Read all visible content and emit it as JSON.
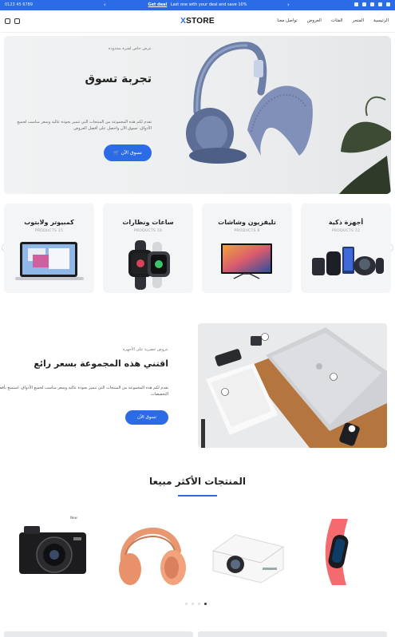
{
  "topbar": {
    "phone": "0123 45 6789",
    "promo_link": "Get deal",
    "promo_text": "Last one with your deal and save 10%",
    "prev_arrow": "‹",
    "next_arrow": "›"
  },
  "header": {
    "logo_prefix": "X",
    "logo_text": "STORE",
    "nav": [
      "الرئيسية",
      "المتجر",
      "الفئات",
      "العروض",
      "تواصل معنا"
    ]
  },
  "hero": {
    "eyebrow": "عرض خاص لفترة محدودة",
    "title": "تجربة تسوق",
    "description": "تقدم لكم هذه المجموعة من المنتجات التي تتميز بجودة عالية وسعر مناسب لجميع الأذواق، تسوق الآن واحصل على أفضل العروض",
    "button_label": "تسوق الآن",
    "button_icon": "cart-icon"
  },
  "categories": [
    {
      "name": "أجهزة ذكية",
      "count": "PRODUCTS 12"
    },
    {
      "name": "تليفزيون وشاشات",
      "count": "PRODUCTS 8"
    },
    {
      "name": "ساعات ونظارات",
      "count": "PRODUCTS 10"
    },
    {
      "name": "كمبيوتر ولابتوب",
      "count": "PRODUCTS 15"
    }
  ],
  "category_nav": {
    "prev": "‹",
    "next": "›"
  },
  "promo": {
    "eyebrow": "عروض حصرية على الأجهزة",
    "title": "اقتني هذه المجموعة بسعر رائع",
    "description": "تقدم لكم هذه المجموعة من المنتجات التي تتميز بجودة عالية وسعر مناسب لجميع الأذواق، استمتع بأفضل التخفيضات",
    "button_label": "تسوق الآن"
  },
  "best_sellers": {
    "title": "المنتجات الأكثر مبيعا",
    "badge": "New",
    "products": [
      "smart-band",
      "projector",
      "headphones",
      "camera"
    ]
  },
  "colors": {
    "accent": "#2b6be6",
    "card_bg": "#f4f5f6"
  }
}
